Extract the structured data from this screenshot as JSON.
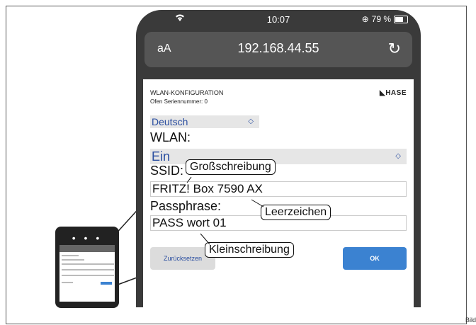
{
  "status": {
    "time": "10:07",
    "battery": "79 %"
  },
  "browser": {
    "aa": "aA",
    "url": "192.168.44.55",
    "reload": "↻"
  },
  "header": {
    "title": "WLAN-KONFIGURATION",
    "subtitle": "Ofen Seriennummer: 0",
    "logo": "HASE"
  },
  "form": {
    "language": "Deutsch",
    "wlan_label": "WLAN:",
    "wlan_value": "Ein",
    "ssid_label": "SSID:",
    "ssid_value": "FRITZ! Box 7590 AX",
    "pass_label": "Passphrase:",
    "pass_value": "PASS wort 01",
    "reset_button": "Zurücksetzen",
    "ok_button": "OK"
  },
  "callouts": {
    "upper": "Großschreibung",
    "space": "Leerzeichen",
    "lower": "Kleinschreibung"
  },
  "small_phone": {
    "dots": "• • •"
  },
  "figure_label": "Bild",
  "colors": {
    "accent": "#3b82d1",
    "select_text": "#2a4ea0",
    "phone_frame": "#3a3a3a"
  }
}
